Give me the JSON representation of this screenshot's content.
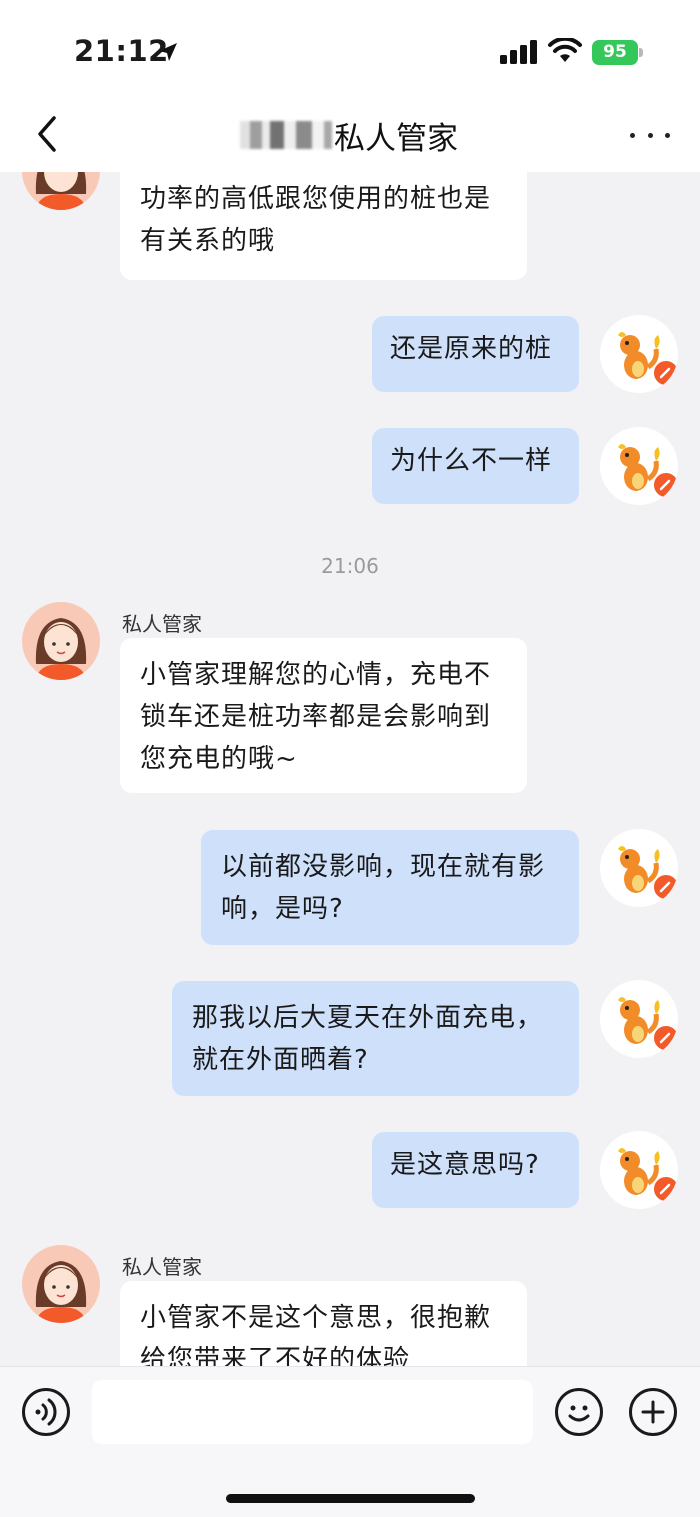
{
  "status_bar": {
    "time": "21:12",
    "battery": "95"
  },
  "header": {
    "title": "私人管家",
    "back_icon": "chevron-left-icon",
    "more_icon": "ellipsis-icon"
  },
  "messages": {
    "m0": {
      "text_line1": "功率的高低跟您使用的桩也是",
      "text_line2": "有关系的哦"
    },
    "m1": {
      "text": "还是原来的桩"
    },
    "m2": {
      "text": "为什么不一样"
    },
    "timestamp": "21:06",
    "m3": {
      "sender": "私人管家",
      "text_line1": "小管家理解您的心情，充电不",
      "text_line2": "锁车还是桩功率都是会影响到",
      "text_line3": "您充电的哦~"
    },
    "m4": {
      "text_line1": "以前都没影响，现在就有影",
      "text_line2": "响，是吗?"
    },
    "m5": {
      "text_line1": "那我以后大夏天在外面充电，",
      "text_line2": "就在外面晒着?"
    },
    "m6": {
      "text": "是这意思吗?"
    },
    "m7": {
      "sender": "私人管家",
      "text_line1": "小管家不是这个意思，很抱歉",
      "text_line2": "给您带来了不好的体验"
    }
  },
  "input_bar": {
    "placeholder": "",
    "voice_icon": "voice-icon",
    "emoji_icon": "emoji-icon",
    "plus_icon": "plus-icon"
  },
  "colors": {
    "outgoing_bubble": "#cfe0fb",
    "incoming_bubble": "#ffffff",
    "background": "#f2f2f5",
    "badge": "#f25a2a",
    "battery": "#34c759"
  }
}
